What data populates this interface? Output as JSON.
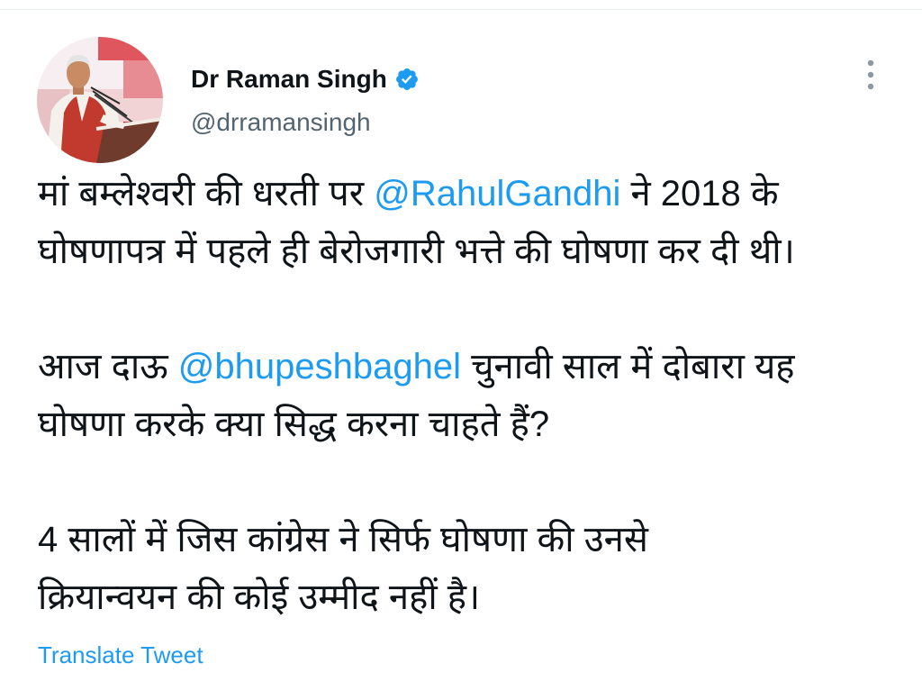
{
  "tweet": {
    "author": {
      "name": "Dr Raman Singh",
      "handle": "@drramansingh",
      "verified": true
    },
    "body": {
      "paragraphs": [
        {
          "lines": [
            {
              "before": "मां बम्लेश्वरी की धरती पर ",
              "mention": "@RahulGandhi",
              "after": " ने 2018 के"
            },
            {
              "text": "घोषणापत्र में पहले ही बेरोजगारी भत्ते की घोषणा कर दी थी।"
            }
          ]
        },
        {
          "lines": [
            {
              "before": "आज दाऊ ",
              "mention": "@bhupeshbaghel",
              "after": " चुनावी साल में दोबारा यह"
            },
            {
              "text": "घोषणा करके क्या सिद्ध करना चाहते हैं?"
            }
          ]
        },
        {
          "lines": [
            {
              "text": "4 सालों में जिस कांग्रेस ने सिर्फ घोषणा की उनसे"
            },
            {
              "text": "क्रियान्वयन की कोई उम्मीद नहीं है।"
            }
          ]
        }
      ]
    },
    "translate_label": "Translate Tweet"
  },
  "icons": {
    "avatar": "profile-photo",
    "verified": "verified-badge-icon",
    "more": "more-vertical-icon"
  },
  "colors": {
    "text": "#0f1419",
    "secondary": "#536471",
    "link": "#1d9bf0",
    "verified": "#1d9bf0",
    "divider": "#e6ecf0",
    "background": "#ffffff"
  }
}
